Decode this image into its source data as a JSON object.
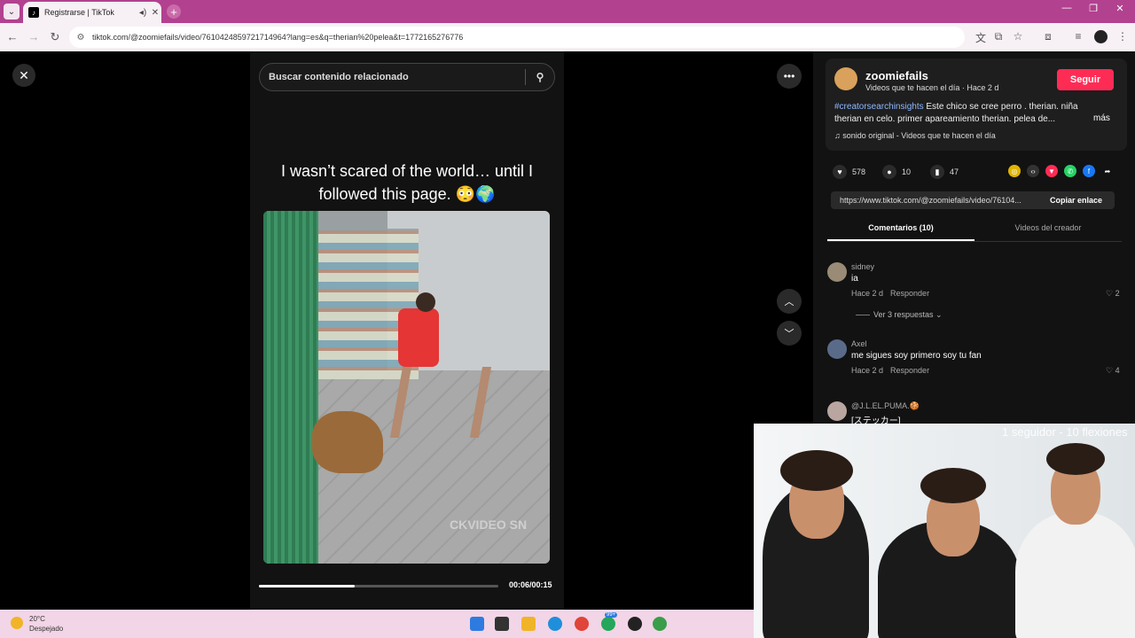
{
  "browser": {
    "tab_title": "Registrarse | TikTok",
    "address": "tiktok.com/@zoomiefails/video/7610424859721714964?lang=es&q=therian%20pelea&t=1772165276776",
    "new_tab_label": "+"
  },
  "page": {
    "search_placeholder": "Buscar contenido relacionado",
    "caption": "I wasn’t scared of the world… until I followed this page. 😳🌍",
    "watermark": "CKVIDEO SN",
    "time": "00:06/00:15",
    "progress": 0.4
  },
  "author": {
    "name": "zoomiefails",
    "subtitle": "Videos que te hacen el día · Hace 2 d",
    "follow_label": "Seguir",
    "hashtag": "#creatorsearchinsights",
    "description": " Este chico se cree perro . therian. niña therian en celo. primer apareamiento therian. pelea de...",
    "more_label": "más",
    "sound": "sonido original - Videos que te hacen el día"
  },
  "stats": {
    "likes": "578",
    "comments": "10",
    "saves": "47"
  },
  "share_link": {
    "url": "https://www.tiktok.com/@zoomiefails/video/76104...",
    "copy_label": "Copiar enlace"
  },
  "tabs": {
    "comments": "Comentarios (10)",
    "creator_videos": "Videos del creador"
  },
  "comments": [
    {
      "user": "sidney",
      "text": "ia",
      "time": "Hace 2 d",
      "reply": "Responder",
      "likes": "2"
    },
    {
      "user": "Axel",
      "text": "me sigues soy primero soy tu fan",
      "time": "Hace 2 d",
      "reply": "Responder",
      "likes": "4"
    },
    {
      "user": "@J.L.EL.PUMA.🍪",
      "text": "[ステッカー]"
    }
  ],
  "replies_label": "Ver 3 respuestas",
  "overlay": {
    "text": "1 seguidor - 10 flexiones"
  },
  "taskbar": {
    "temp": "20°C",
    "weather": "Despejado",
    "badge": "99+"
  },
  "colors": {
    "follow": "#fe2c55",
    "hashtag": "#8fb8ff",
    "tab_bar": "#b2418f"
  }
}
